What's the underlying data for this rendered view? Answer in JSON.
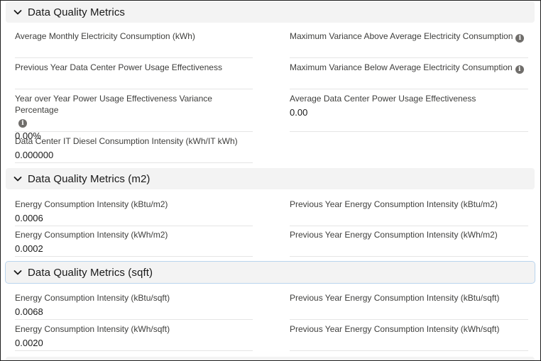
{
  "sections": [
    {
      "title": "Data Quality Metrics",
      "fields": [
        {
          "label": "Average Monthly Electricity Consumption (kWh)",
          "value": ""
        },
        {
          "label": "Maximum Variance Above Average Electricity Consumption",
          "value": "",
          "info": true
        },
        {
          "label": "Previous Year Data Center Power Usage Effectiveness",
          "value": ""
        },
        {
          "label": "Maximum Variance Below Average Electricity Consumption",
          "value": "",
          "info": true
        },
        {
          "label": "Year over Year Power Usage Effectiveness Variance Percentage",
          "value": "0.00%",
          "info": true
        },
        {
          "label": "Average Data Center Power Usage Effectiveness",
          "value": "0.00"
        },
        {
          "label": "Data Center IT Diesel Consumption Intensity (kWh/IT kWh)",
          "value": "0.000000"
        }
      ]
    },
    {
      "title": "Data Quality Metrics (m2)",
      "fields": [
        {
          "label": "Energy Consumption Intensity (kBtu/m2)",
          "value": "0.0006"
        },
        {
          "label": "Previous Year Energy Consumption Intensity (kBtu/m2)",
          "value": ""
        },
        {
          "label": "Energy Consumption Intensity (kWh/m2)",
          "value": "0.0002"
        },
        {
          "label": "Previous Year Energy Consumption Intensity (kWh/m2)",
          "value": ""
        }
      ]
    },
    {
      "title": "Data Quality Metrics (sqft)",
      "fields": [
        {
          "label": "Energy Consumption Intensity (kBtu/sqft)",
          "value": "0.0068"
        },
        {
          "label": "Previous Year Energy Consumption Intensity (kBtu/sqft)",
          "value": ""
        },
        {
          "label": "Energy Consumption Intensity (kWh/sqft)",
          "value": "0.0020"
        },
        {
          "label": "Previous Year Energy Consumption Intensity (kWh/sqft)",
          "value": ""
        }
      ]
    }
  ],
  "icons": {
    "section_toggle": "chevron-down-icon",
    "help": "info-icon"
  }
}
